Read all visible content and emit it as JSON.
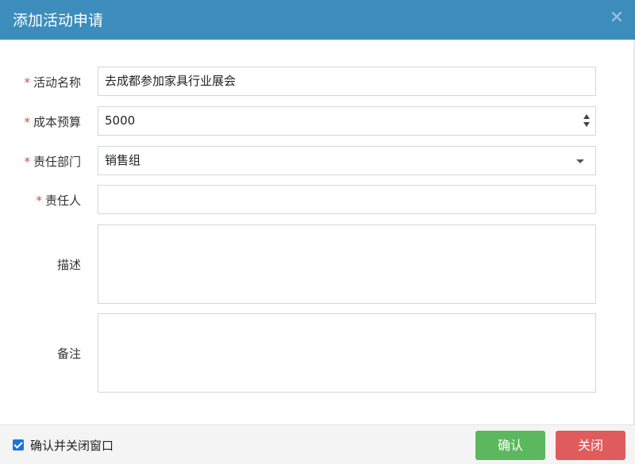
{
  "dialog": {
    "title": "添加活动申请",
    "close_symbol": "✕"
  },
  "form": {
    "required_mark": "*",
    "name": {
      "label": "活动名称",
      "value": "去成都参加家具行业展会",
      "required": true
    },
    "budget": {
      "label": "成本预算",
      "value": "5000",
      "required": true
    },
    "department": {
      "label": "责任部门",
      "value": "销售组",
      "required": true
    },
    "owner": {
      "label": "责任人",
      "value": "",
      "required": true
    },
    "description": {
      "label": "描述",
      "value": ""
    },
    "remark": {
      "label": "备注",
      "value": ""
    }
  },
  "footer": {
    "checkbox_label": "确认并关闭窗口",
    "checkbox_checked": true,
    "confirm_label": "确认",
    "close_label": "关闭"
  },
  "colors": {
    "titlebar": "#3c8dbc",
    "required": "#dd4b39",
    "confirm": "#5cb85c",
    "close": "#e05b5b"
  }
}
